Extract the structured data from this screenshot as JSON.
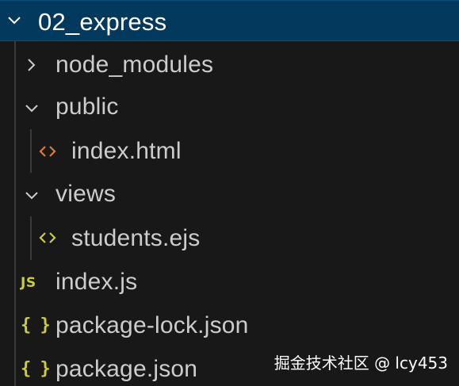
{
  "root_folder": {
    "name": "02_express",
    "expanded": true
  },
  "items": [
    {
      "label": "node_modules",
      "type": "folder",
      "expanded": false
    },
    {
      "label": "public",
      "type": "folder",
      "expanded": true
    },
    {
      "label": "index.html",
      "type": "file",
      "icon": "html-icon",
      "icon_color": "#e37933"
    },
    {
      "label": "views",
      "type": "folder",
      "expanded": true
    },
    {
      "label": "students.ejs",
      "type": "file",
      "icon": "ejs-icon",
      "icon_color": "#cbcb41"
    },
    {
      "label": "index.js",
      "type": "file",
      "icon": "js-icon",
      "icon_glyph": "JS",
      "icon_color": "#cbcb41"
    },
    {
      "label": "package-lock.json",
      "type": "file",
      "icon": "json-icon",
      "icon_glyph": "{ }",
      "icon_color": "#cbcb41"
    },
    {
      "label": "package.json",
      "type": "file",
      "icon": "json-icon",
      "icon_glyph": "{ }",
      "icon_color": "#cbcb41"
    }
  ],
  "watermark": "掘金技术社区 @ lcy453",
  "colors": {
    "background": "#181818",
    "selection": "#04395e",
    "text": "#cccccc",
    "indent_guide": "#3a3a3a"
  }
}
